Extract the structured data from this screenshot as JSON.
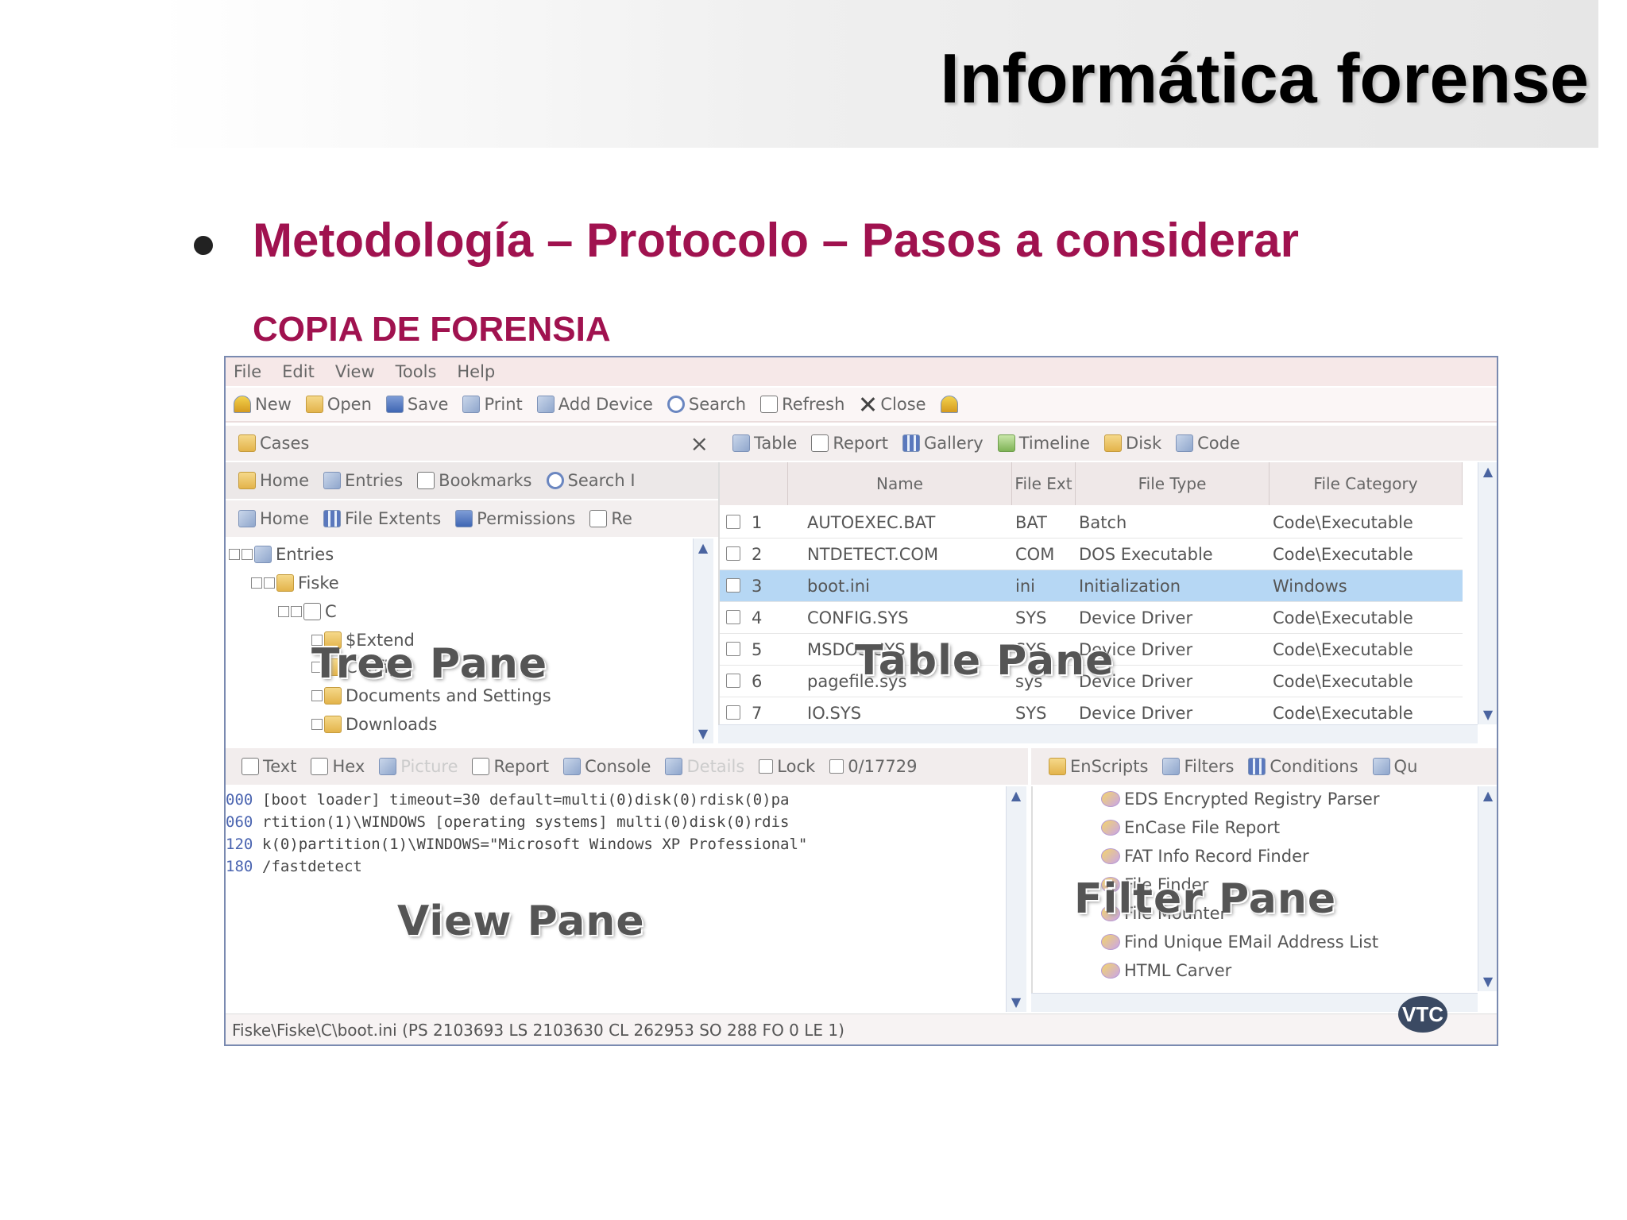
{
  "slide": {
    "title": "Informática forense",
    "bullet": "Metodología – Protocolo – Pasos a considerar",
    "subtitle": "COPIA DE FORENSIA"
  },
  "app": {
    "menu": [
      "File",
      "Edit",
      "View",
      "Tools",
      "Help"
    ],
    "toolbar": [
      "New",
      "Open",
      "Save",
      "Print",
      "Add Device",
      "Search",
      "Refresh",
      "Close"
    ],
    "left_tabs": [
      "Cases"
    ],
    "left_row2": [
      "Home",
      "Entries",
      "Bookmarks",
      "Search I"
    ],
    "left_row3": [
      "Home",
      "File Extents",
      "Permissions",
      "Re"
    ],
    "tree": [
      "Entries",
      "Fiske",
      "C",
      "$Extend",
      "Config",
      "Documents and Settings",
      "Downloads"
    ],
    "overlays": {
      "tree": "Tree Pane",
      "table": "Table Pane",
      "view": "View Pane",
      "filter": "Filter Pane"
    },
    "right_tabs": [
      "Table",
      "Report",
      "Gallery",
      "Timeline",
      "Disk",
      "Code"
    ],
    "table_headers": {
      "name": "Name",
      "ext": "File Ext",
      "type": "File Type",
      "category": "File Category"
    },
    "rows": [
      {
        "n": "1",
        "name": "AUTOEXEC.BAT",
        "ext": "BAT",
        "type": "Batch",
        "cat": "Code\\Executable"
      },
      {
        "n": "2",
        "name": "NTDETECT.COM",
        "ext": "COM",
        "type": "DOS Executable",
        "cat": "Code\\Executable"
      },
      {
        "n": "3",
        "name": "boot.ini",
        "ext": "ini",
        "type": "Initialization",
        "cat": "Windows"
      },
      {
        "n": "4",
        "name": "CONFIG.SYS",
        "ext": "SYS",
        "type": "Device Driver",
        "cat": "Code\\Executable"
      },
      {
        "n": "5",
        "name": "MSDOS.SYS",
        "ext": "SYS",
        "type": "Device Driver",
        "cat": "Code\\Executable"
      },
      {
        "n": "6",
        "name": "pagefile.sys",
        "ext": "sys",
        "type": "Device Driver",
        "cat": "Code\\Executable"
      },
      {
        "n": "7",
        "name": "IO.SYS",
        "ext": "SYS",
        "type": "Device Driver",
        "cat": "Code\\Executable"
      }
    ],
    "bottom_tabs": [
      "Text",
      "Hex",
      "Picture",
      "Report",
      "Console",
      "Details",
      "Lock",
      "0/17729"
    ],
    "hex": [
      {
        "off": "000",
        "text": "[boot loader]  timeout=30  default=multi(0)disk(0)rdisk(0)pa"
      },
      {
        "off": "060",
        "text": "rtition(1)\\WINDOWS  [operating systems]  multi(0)disk(0)rdis"
      },
      {
        "off": "120",
        "text": "k(0)partition(1)\\WINDOWS=\"Microsoft Windows XP Professional\""
      },
      {
        "off": "180",
        "text": " /fastdetect"
      }
    ],
    "filter_tabs": [
      "EnScripts",
      "Filters",
      "Conditions",
      "Qu"
    ],
    "filters": [
      "EDS Encrypted Registry Parser",
      "EnCase File Report",
      "FAT Info Record Finder",
      "File Finder",
      "File Mounter",
      "Find Unique EMail Address List",
      "HTML Carver"
    ],
    "status": "Fiske\\Fiske\\C\\boot.ini (PS 2103693  LS 2103630  CL 262953  SO 288  FO 0  LE 1)",
    "logo": "VTC"
  }
}
